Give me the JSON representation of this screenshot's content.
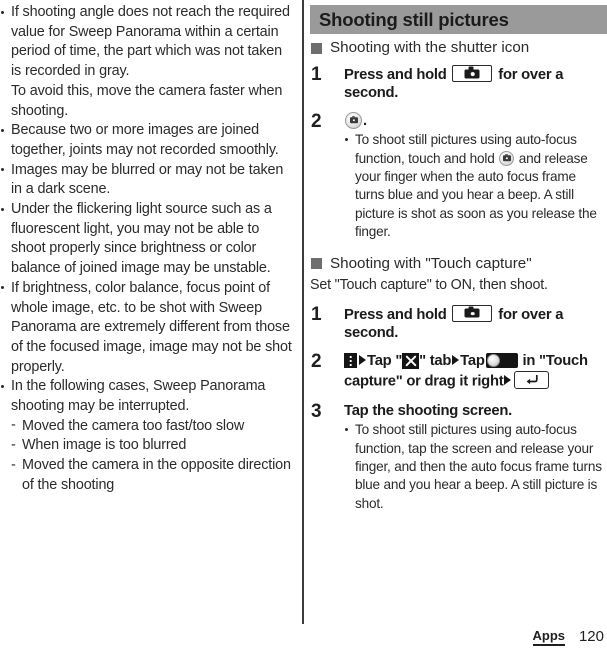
{
  "page": {
    "number": "120",
    "tab_label": "Apps"
  },
  "left_column": {
    "bullets": [
      {
        "paragraphs": [
          "If shooting angle does not reach the required value for Sweep Panorama within a certain period of time, the part which was not taken is recorded in gray.",
          "To avoid this, move the camera faster when shooting."
        ]
      },
      {
        "paragraphs": [
          "Because two or more images are joined together, joints may not recorded smoothly."
        ]
      },
      {
        "paragraphs": [
          "Images may be blurred or may not be taken in a dark scene."
        ]
      },
      {
        "paragraphs": [
          "Under the flickering light source such as a fluorescent light, you may not be able to shoot properly since brightness or color balance of joined image may be unstable."
        ]
      },
      {
        "paragraphs": [
          "If brightness, color balance, focus point of whole image, etc. to be shot with Sweep Panorama are extremely different from those of the focused image, image may not be shot properly."
        ]
      },
      {
        "paragraphs": [
          "In the following cases, Sweep Panorama shooting may be interrupted."
        ],
        "sub_items": [
          {
            "dash": "-",
            "text": "Moved the camera too fast/too slow"
          },
          {
            "dash": "-",
            "text": "When image is too blurred"
          },
          {
            "dash": "-",
            "text": "Moved the camera in the opposite direction of the shooting"
          }
        ]
      }
    ]
  },
  "right_column": {
    "banner": {
      "title": "Shooting still pictures",
      "background": "#9a9a9a"
    },
    "section_shutter_icon": {
      "heading": "Shooting with the shutter icon",
      "marker_icon": "filled-square-marker",
      "steps": [
        {
          "number": "1",
          "title_parts": [
            {
              "type": "text",
              "value": "Press and hold "
            },
            {
              "type": "icon",
              "value": "camera-key-icon"
            },
            {
              "type": "text",
              "value": " for over a second."
            }
          ]
        },
        {
          "number": "2",
          "title_parts": [
            {
              "type": "icon",
              "value": "shutter-button-icon"
            },
            {
              "type": "text",
              "value": "."
            }
          ],
          "notes": [
            {
              "parts": [
                {
                  "type": "text",
                  "value": "To shoot still pictures using auto-focus function, touch and hold "
                },
                {
                  "type": "icon",
                  "value": "shutter-button-icon"
                },
                {
                  "type": "text",
                  "value": " and release your finger when the auto focus frame turns blue and you hear a beep. A still picture is shot as soon as you release the finger."
                }
              ]
            }
          ]
        }
      ]
    },
    "section_touch_capture": {
      "heading": "Shooting with \"Touch capture\"",
      "marker_icon": "filled-square-marker",
      "intro": "Set \"Touch capture\" to ON, then shoot.",
      "steps": [
        {
          "number": "1",
          "title_parts": [
            {
              "type": "text",
              "value": "Press and hold "
            },
            {
              "type": "icon",
              "value": "camera-key-icon"
            },
            {
              "type": "text",
              "value": " for over a second."
            }
          ]
        },
        {
          "number": "2",
          "title_parts": [
            {
              "type": "icon",
              "value": "overflow-menu-icon"
            },
            {
              "type": "icon",
              "value": "arrow-separator-icon"
            },
            {
              "type": "text",
              "value": "Tap \""
            },
            {
              "type": "icon",
              "value": "tools-tab-icon"
            },
            {
              "type": "text",
              "value": "\" tab"
            },
            {
              "type": "icon",
              "value": "arrow-separator-icon"
            },
            {
              "type": "text",
              "value": "Tap"
            },
            {
              "type": "icon",
              "value": "toggle-off-icon"
            },
            {
              "type": "text",
              "value": " in \"Touch capture\" or drag it right"
            },
            {
              "type": "icon",
              "value": "arrow-separator-icon"
            },
            {
              "type": "icon",
              "value": "back-key-icon"
            },
            {
              "type": "text",
              "value": "."
            }
          ]
        },
        {
          "number": "3",
          "title_parts": [
            {
              "type": "text",
              "value": "Tap the shooting screen."
            }
          ],
          "notes": [
            {
              "parts": [
                {
                  "type": "text",
                  "value": "To shoot still pictures using auto-focus function, tap the screen and release your finger, and then the auto focus frame turns blue and you hear a beep. A still picture is shot."
                }
              ]
            }
          ]
        }
      ]
    }
  }
}
